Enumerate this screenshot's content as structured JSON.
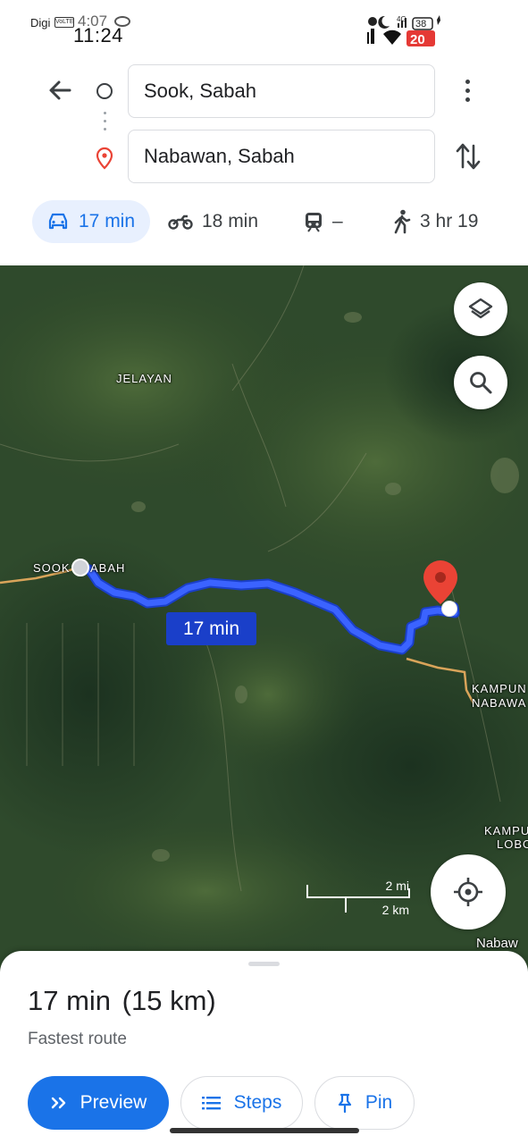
{
  "status_bar": {
    "carrier": "Digi",
    "volte": "VoLTE",
    "ghost_time": "4:07",
    "time": "11:24",
    "network": "4G",
    "battery": "38",
    "notification_count": "20"
  },
  "directions": {
    "origin": "Sook, Sabah",
    "destination": "Nabawan, Sabah"
  },
  "travel_modes": [
    {
      "mode": "drive",
      "label": "17 min",
      "selected": true
    },
    {
      "mode": "motorcycle",
      "label": "18 min"
    },
    {
      "mode": "transit",
      "label": "–"
    },
    {
      "mode": "walk",
      "label": "3 hr 19"
    }
  ],
  "map": {
    "places": {
      "jelayan": "JELAYAN",
      "sook_left": "SOOK",
      "sook_right": "ABAH",
      "kampung_nabawan_1": "KAMPUN",
      "kampung_nabawan_2": "NABAWA",
      "kampung_lobo_1": "KAMPU",
      "kampung_lobo_2": "LOBO",
      "nabawan": "Nabaw"
    },
    "route_duration": "17 min",
    "scale": {
      "miles": "2 mi",
      "km": "2 km"
    }
  },
  "sheet": {
    "duration": "17 min",
    "distance": "(15 km)",
    "route_type": "Fastest route",
    "preview_label": "Preview",
    "steps_label": "Steps",
    "pin_label": "Pin"
  },
  "colors": {
    "accent": "#1a73e8",
    "route": "#2b4cff",
    "destination_pin": "#ea4335"
  }
}
